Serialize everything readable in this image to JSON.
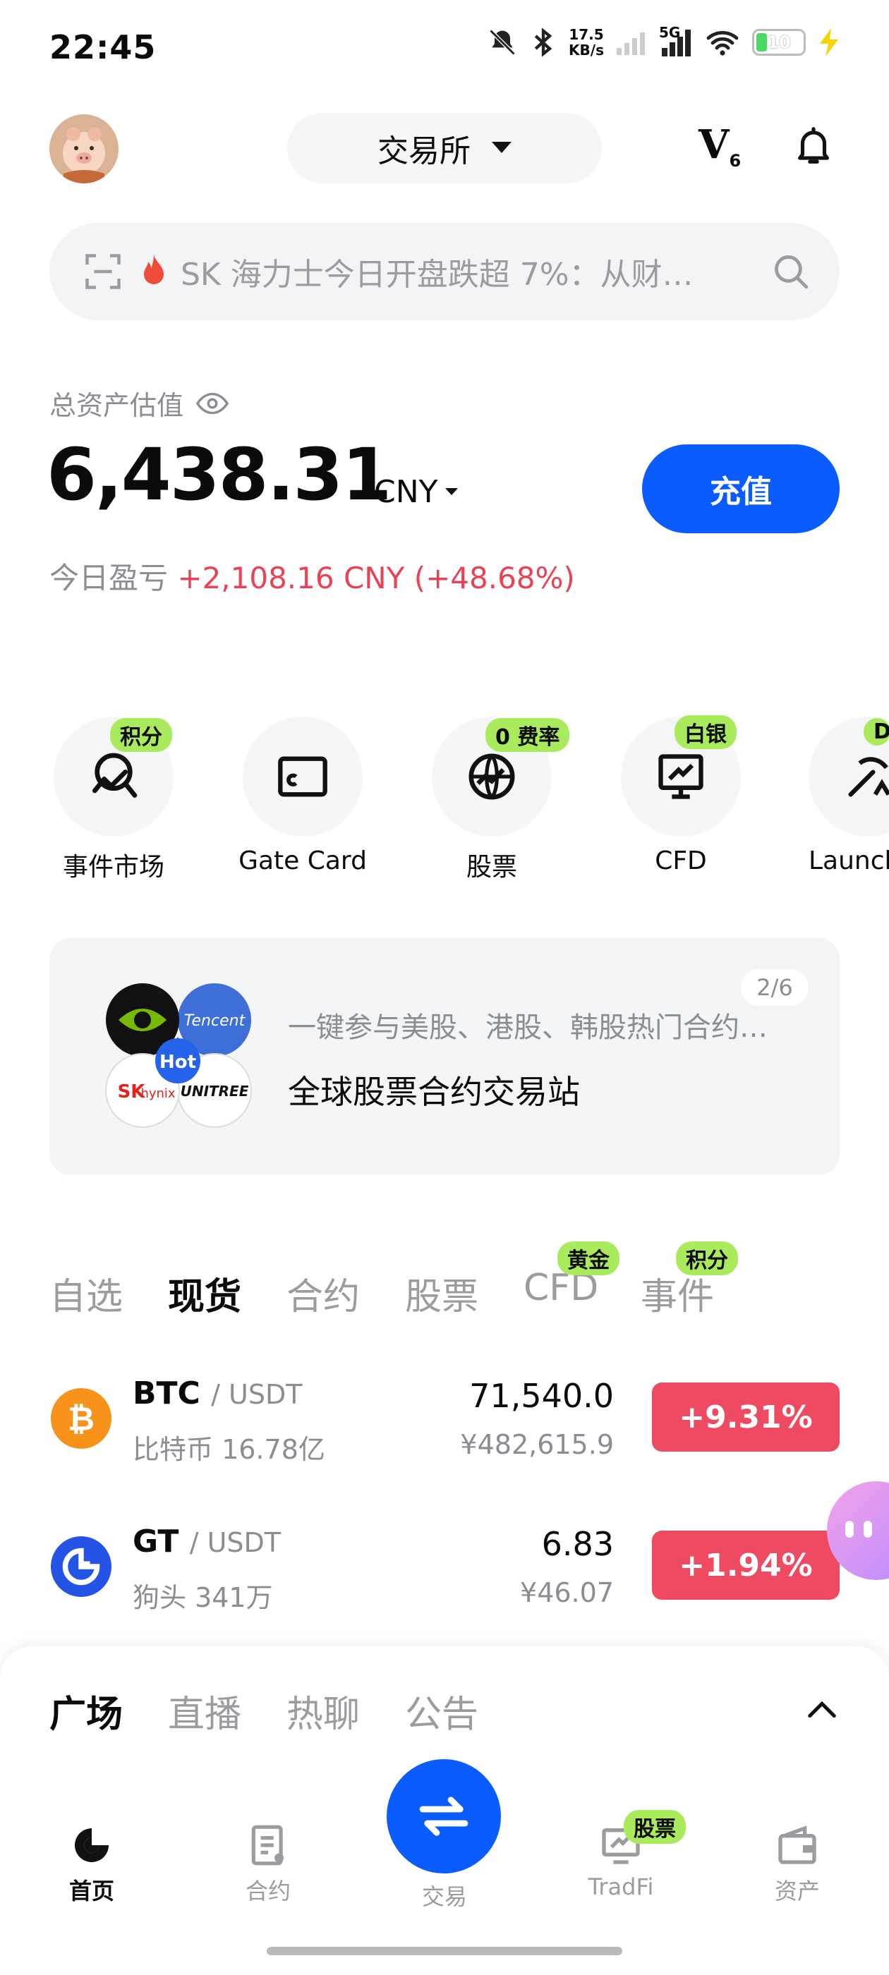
{
  "status_bar": {
    "time": "22:45",
    "net_speed_value": "17.5",
    "net_speed_unit": "KB/s",
    "network": "5G",
    "battery": "10"
  },
  "header": {
    "exchange_label": "交易所",
    "vip_letter": "V",
    "vip_level": "6"
  },
  "search": {
    "text": "SK 海力士今日开盘跌超 7%：从财…"
  },
  "assets": {
    "label": "总资产估值",
    "value": "6,438.31",
    "currency": "CNY",
    "deposit_label": "充值",
    "pnl_label": "今日盈亏",
    "pnl_value": "+2,108.16 CNY (+48.68%)"
  },
  "shortcuts": [
    {
      "label": "事件市场",
      "tag": "积分",
      "icon": "event-market-icon"
    },
    {
      "label": "Gate Card",
      "tag": "",
      "icon": "card-icon"
    },
    {
      "label": "股票",
      "tag": "0 费率",
      "icon": "globe-icon"
    },
    {
      "label": "CFD",
      "tag": "白银",
      "icon": "chart-monitor-icon"
    },
    {
      "label": "Launchp",
      "tag": "D",
      "icon": "pickaxe-icon"
    }
  ],
  "banner": {
    "counter": "2/6",
    "subtitle": "一键参与美股、港股、韩股热门合约…",
    "title": "全球股票合约交易站",
    "hot_label": "Hot",
    "logo_tencent": "Tencent",
    "logo_sk": "SK",
    "logo_hynix": "hynix",
    "logo_unitree": "UNITREE"
  },
  "market_tabs": [
    {
      "label": "自选",
      "tag": ""
    },
    {
      "label": "现货",
      "tag": "",
      "active": true
    },
    {
      "label": "合约",
      "tag": ""
    },
    {
      "label": "股票",
      "tag": ""
    },
    {
      "label": "CFD",
      "tag": "黄金"
    },
    {
      "label": "事件",
      "tag": "积分"
    }
  ],
  "market_rows": [
    {
      "base": "BTC",
      "quote": "/ USDT",
      "name_volume": "比特币 16.78亿",
      "price": "71,540.0",
      "fiat": "¥482,615.9",
      "change": "+9.31%",
      "icon": "bitcoin-icon",
      "icon_color": "#f7931a"
    },
    {
      "base": "GT",
      "quote": "/ USDT",
      "name_volume": "狗头 341万",
      "price": "6.83",
      "fiat": "¥46.07",
      "change": "+1.94%",
      "icon": "gatetoken-icon",
      "icon_color": "#2354e6"
    }
  ],
  "sheet_tabs": [
    "广场",
    "直播",
    "热聊",
    "公告"
  ],
  "bottom_nav": {
    "home": "首页",
    "futures": "合约",
    "trade": "交易",
    "tradfi": "TradFi",
    "tradfi_tag": "股票",
    "assets": "资产"
  },
  "colors": {
    "brand_blue": "#0b5cff",
    "positive_red": "#ee4a62",
    "tag_green": "#a9eb5c"
  }
}
